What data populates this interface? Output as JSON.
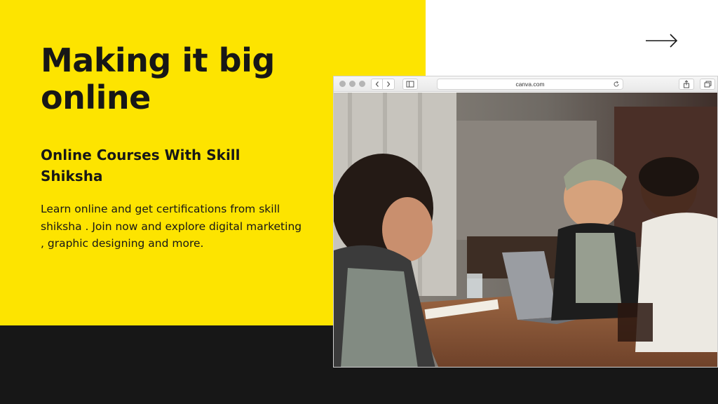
{
  "slide": {
    "headline": "Making it big online",
    "subheading": "Online Courses With Skill Shiksha",
    "description": "Learn online and get certifications from skill shiksha . Join now and explore digital marketing , graphic designing and more.",
    "next_icon": "arrow-right-icon"
  },
  "browser": {
    "address": "canva.com",
    "icons": [
      "chevron-left-icon",
      "chevron-right-icon",
      "sidebar-icon",
      "reload-icon",
      "share-icon",
      "tabs-icon"
    ]
  },
  "colors": {
    "accent_yellow": "#fde400",
    "dark": "#171717",
    "white": "#ffffff"
  }
}
